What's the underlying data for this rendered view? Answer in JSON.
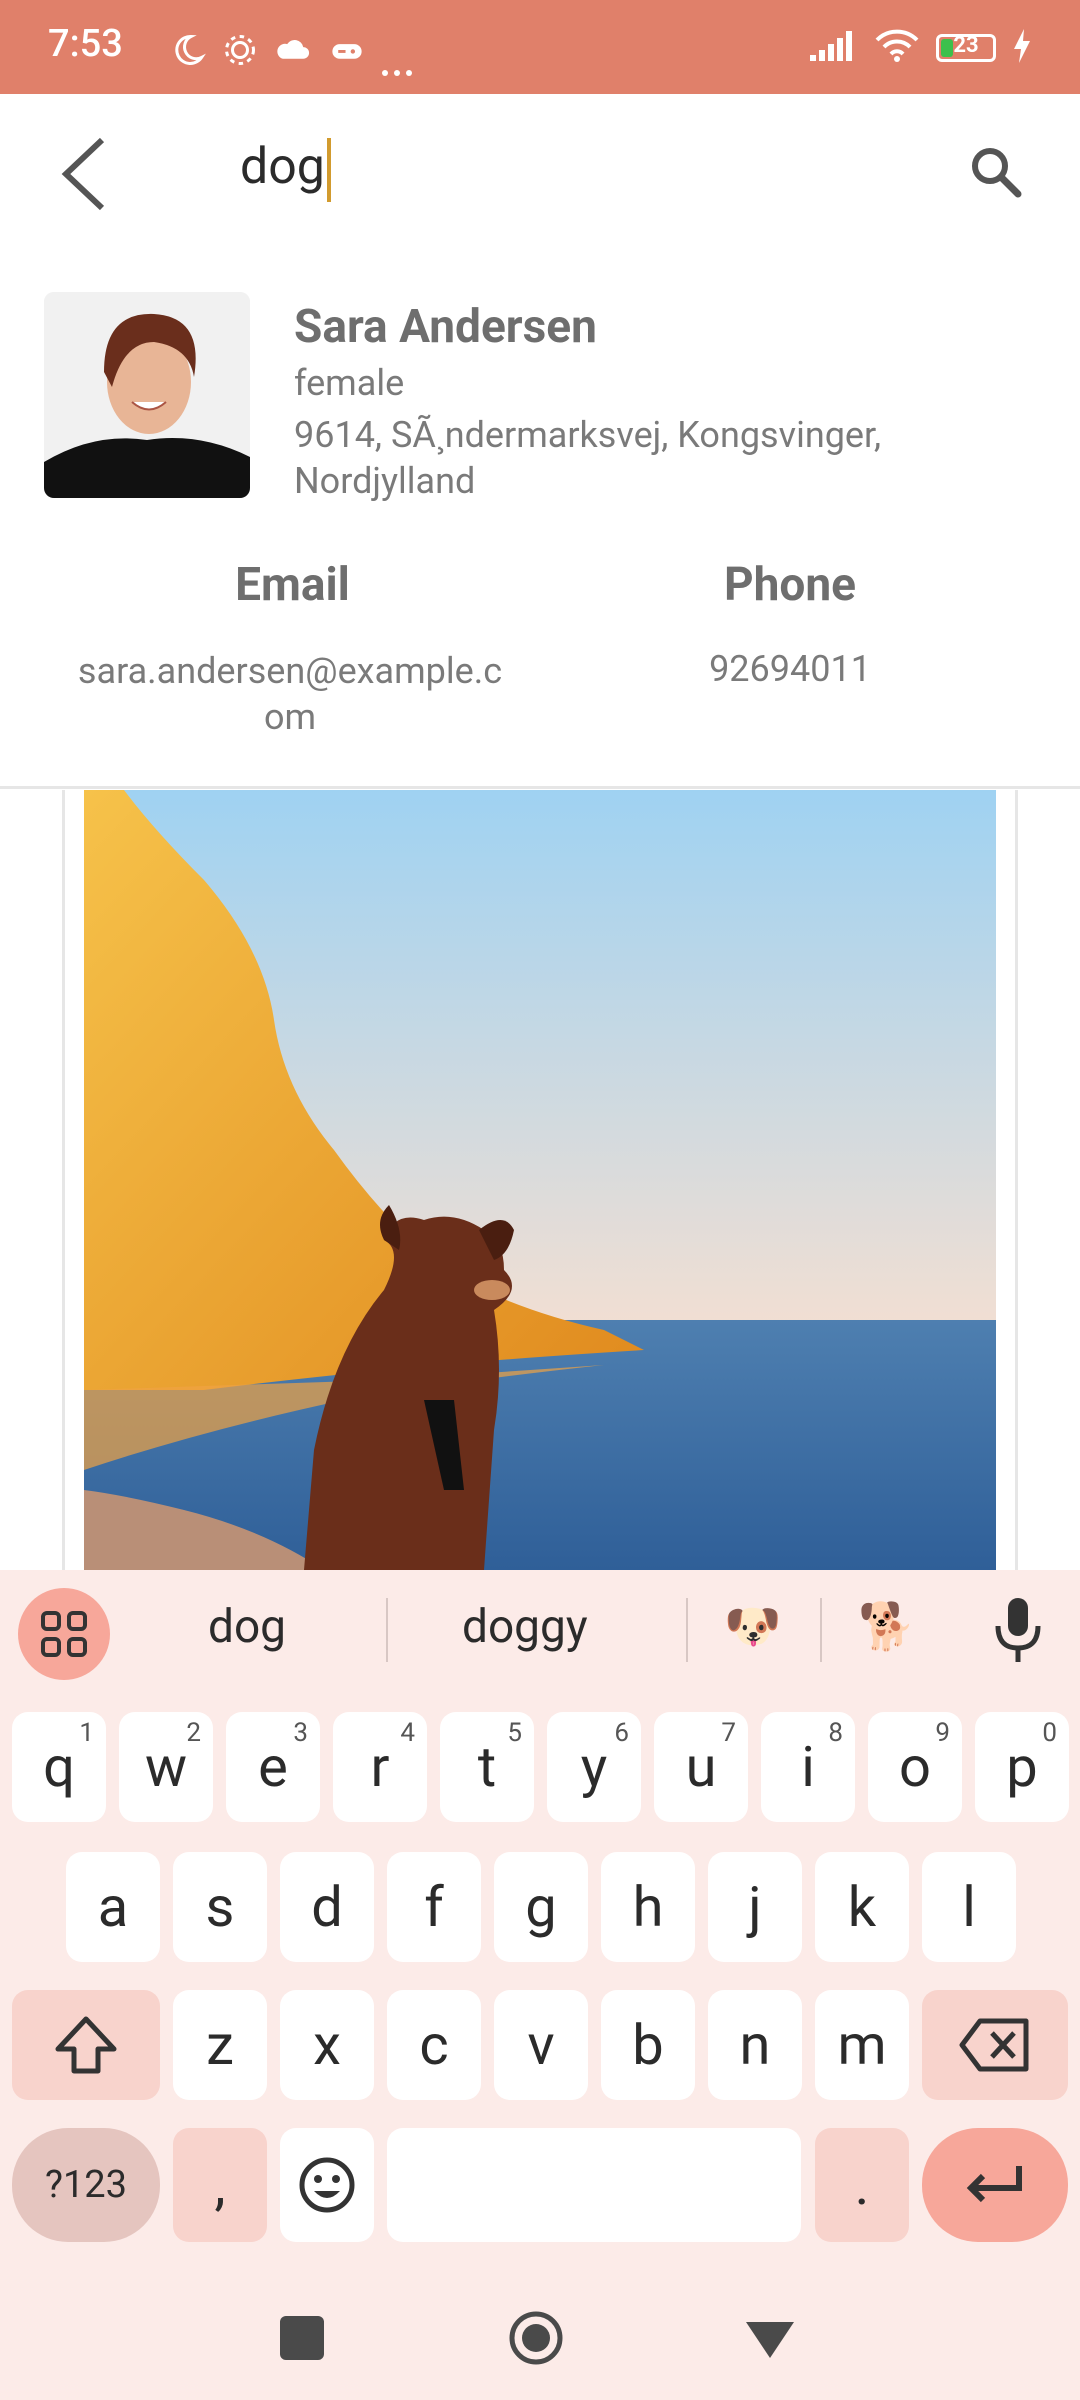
{
  "status_bar": {
    "time": "7:53",
    "battery_level": "23"
  },
  "search": {
    "query": "dog"
  },
  "profile": {
    "name": "Sara Andersen",
    "gender": "female",
    "address": "9614, SÃ¸ndermarksvej, Kongsvinger, Nordjylland",
    "email_title": "Email",
    "email": "sara.andersen@example.com",
    "phone_title": "Phone",
    "phone": "92694011"
  },
  "keyboard": {
    "suggestions": [
      "dog",
      "doggy",
      "🐶",
      "🐕"
    ],
    "row1": [
      {
        "k": "q",
        "n": "1"
      },
      {
        "k": "w",
        "n": "2"
      },
      {
        "k": "e",
        "n": "3"
      },
      {
        "k": "r",
        "n": "4"
      },
      {
        "k": "t",
        "n": "5"
      },
      {
        "k": "y",
        "n": "6"
      },
      {
        "k": "u",
        "n": "7"
      },
      {
        "k": "i",
        "n": "8"
      },
      {
        "k": "o",
        "n": "9"
      },
      {
        "k": "p",
        "n": "0"
      }
    ],
    "row2": [
      "a",
      "s",
      "d",
      "f",
      "g",
      "h",
      "j",
      "k",
      "l"
    ],
    "row3": [
      "z",
      "x",
      "c",
      "v",
      "b",
      "n",
      "m"
    ],
    "sym_label": "?123",
    "comma": ",",
    "period": "."
  },
  "colors": {
    "status_bg": "#E0806A",
    "accent": "#F7A79A",
    "keyboard_bg": "#FCEBE8"
  }
}
